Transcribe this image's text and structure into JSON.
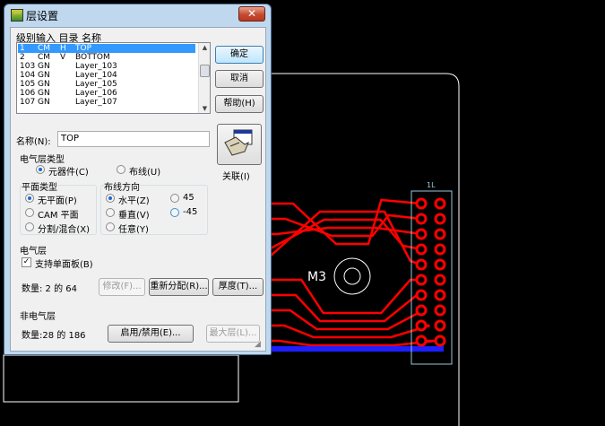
{
  "dialog": {
    "title": "层设置",
    "close_label": "✕",
    "list_headers": "级别输入 目录 名称",
    "layers": [
      {
        "level": "1",
        "type": "CM",
        "dir": "H",
        "name": "TOP"
      },
      {
        "level": "2",
        "type": "CM",
        "dir": "V",
        "name": "BOTTOM"
      },
      {
        "level": "103",
        "type": "GN",
        "dir": "",
        "name": "Layer_103"
      },
      {
        "level": "104",
        "type": "GN",
        "dir": "",
        "name": "Layer_104"
      },
      {
        "level": "105",
        "type": "GN",
        "dir": "",
        "name": "Layer_105"
      },
      {
        "level": "106",
        "type": "GN",
        "dir": "",
        "name": "Layer_106"
      },
      {
        "level": "107",
        "type": "GN",
        "dir": "",
        "name": "Layer_107"
      }
    ],
    "buttons": {
      "ok": "确定",
      "cancel": "取消",
      "help": "帮助(H)",
      "associate": "关联(I)",
      "modify": "修改(F)...",
      "reassign": "重新分配(R)...",
      "thickness": "厚度(T)...",
      "enable_disable": "启用/禁用(E)...",
      "max_layers": "最大层(L)..."
    },
    "name_label": "名称(N):",
    "name_value": "TOP",
    "electrical_layer_type": {
      "title": "电气层类型",
      "component": "元器件(C)",
      "routing": "布线(U)"
    },
    "plane_type": {
      "title": "平面类型",
      "no_plane": "无平面(P)",
      "cam_plane": "CAM 平面",
      "split_mixed": "分割/混合(X)"
    },
    "routing_direction": {
      "title": "布线方向",
      "horizontal": "水平(Z)",
      "vertical": "垂直(V)",
      "any": "任意(Y)",
      "deg45": "45",
      "degm45": "-45"
    },
    "electrical_layers": {
      "title": "电气层",
      "single_side_label": "支持单面板(B)",
      "count": "数量: 2 的 64"
    },
    "non_electrical_layers": {
      "title": "非电气层",
      "count": "数量:28 的 186"
    }
  },
  "pcb": {
    "component_label": "M3",
    "ref_label": "1L"
  },
  "colors": {
    "trace": "#ff0000",
    "bottom_trace": "#1e1eff",
    "outline": "#ffffff",
    "pad_outline": "#9ac8dc",
    "background": "#000000"
  }
}
